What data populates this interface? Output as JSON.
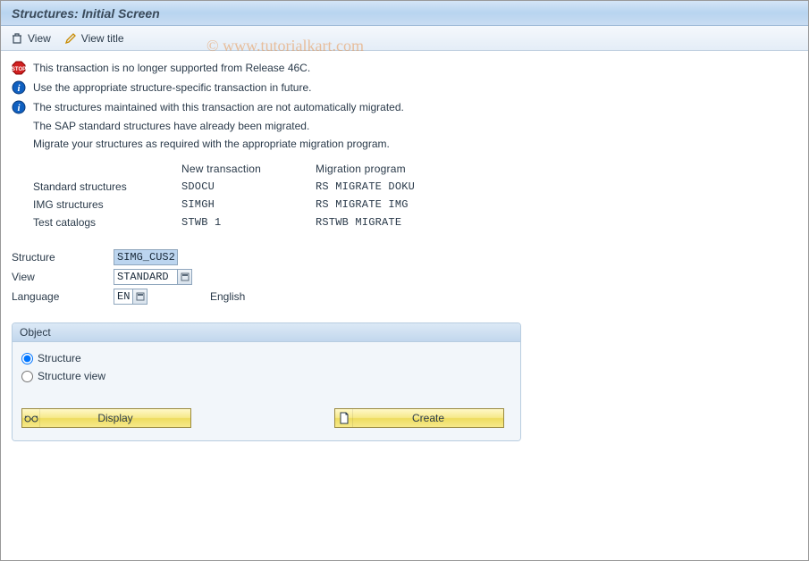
{
  "title": "Structures: Initial Screen",
  "toolbar": {
    "view": "View",
    "view_title": "View title"
  },
  "messages": {
    "m1": "This transaction is  no longer supported from Release 46C.",
    "m2": "Use the appropriate structure-specific transaction in future.",
    "m3": "The structures maintained with this transaction are not automatically migrated.",
    "m4": "The SAP standard structures have already been migrated.",
    "m5": "Migrate your structures as required with the appropriate migration program."
  },
  "table": {
    "headers": {
      "a": "",
      "b": "New transaction",
      "c": "Migration program"
    },
    "rows": [
      {
        "a": "Standard structures",
        "b": "SDOCU",
        "c": "RS MIGRATE DOKU"
      },
      {
        "a": "IMG structures",
        "b": "SIMGH",
        "c": "RS MIGRATE IMG"
      },
      {
        "a": "Test catalogs",
        "b": "STWB 1",
        "c": "RSTWB MIGRATE"
      }
    ]
  },
  "form": {
    "structure_label": "Structure",
    "structure_value": "SIMG_CUS2",
    "view_label": "View",
    "view_value": "STANDARD",
    "language_label": "Language",
    "language_value": "EN",
    "language_text": "English"
  },
  "object_group": {
    "title": "Object",
    "opt1": "Structure",
    "opt2": "Structure view",
    "display": "Display",
    "create": "Create"
  },
  "watermark": "© www.tutorialkart.com"
}
